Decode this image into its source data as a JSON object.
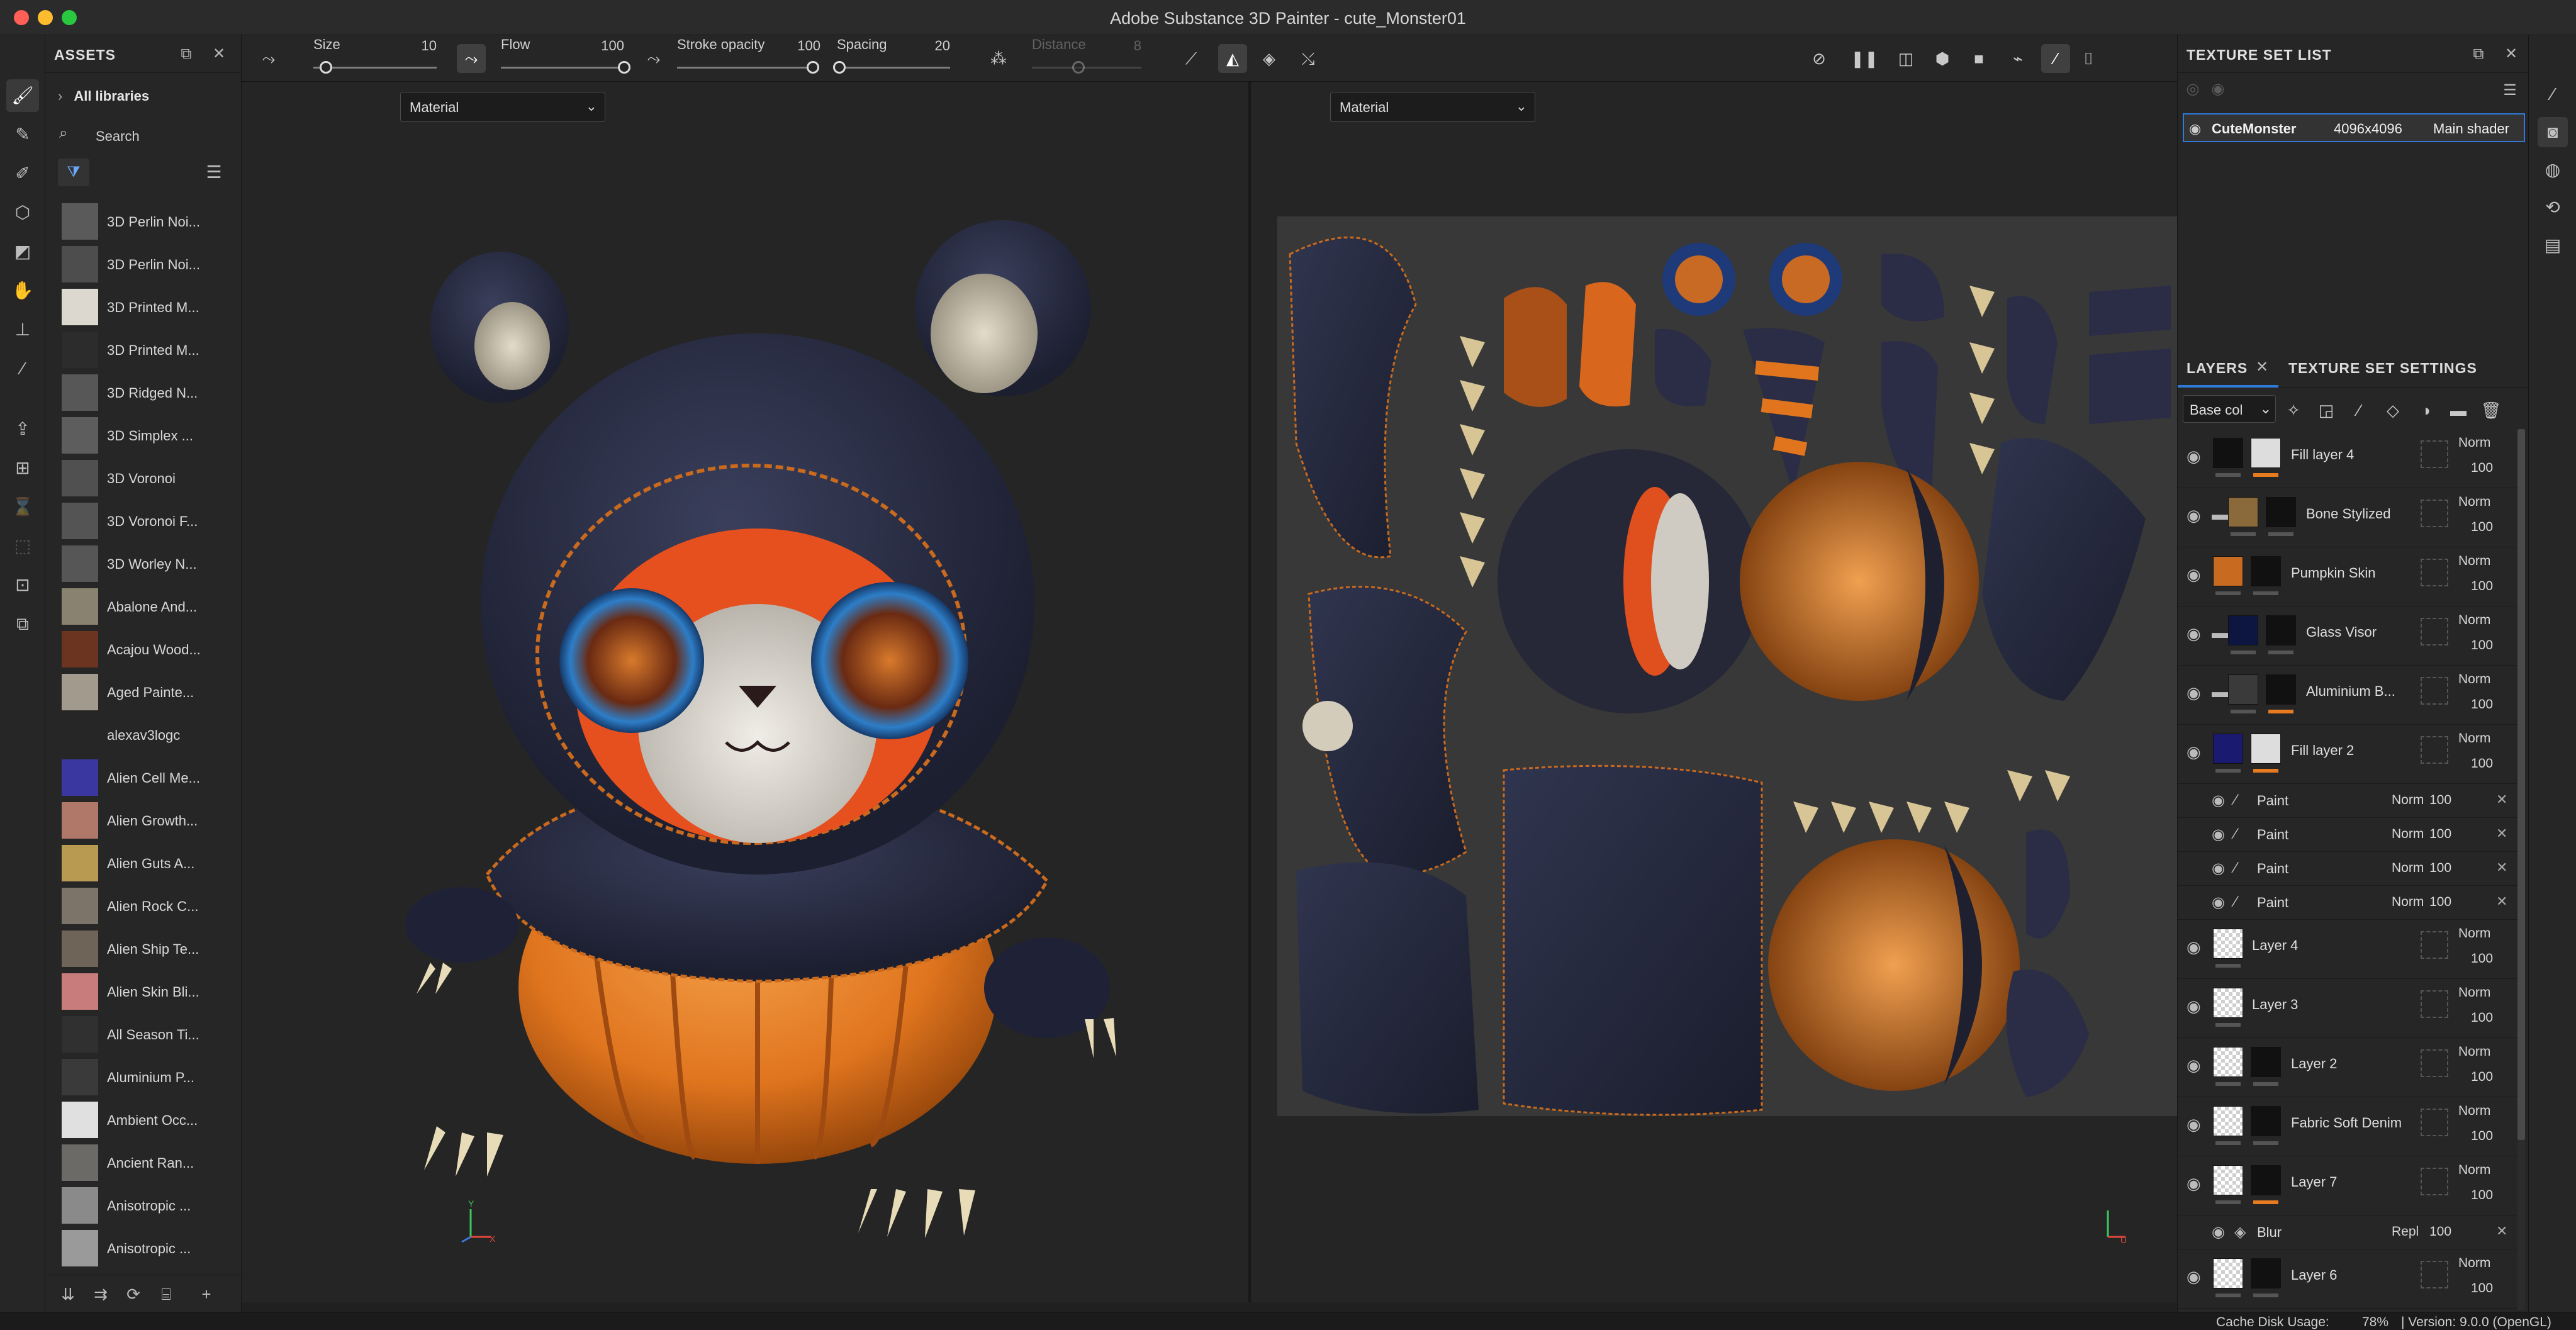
{
  "window": {
    "title": "Adobe Substance 3D Painter - cute_Monster01"
  },
  "tool_strip": {
    "icons": [
      "paint-brush-icon",
      "eraser-icon",
      "projection-icon",
      "geometry-mask-icon",
      "polygon-fill-icon",
      "smudge-icon",
      "clone-stamp-icon",
      "color-picker-icon",
      "export-icon",
      "bake-icon",
      "hidden-tool-icon",
      "hidden-tool-icon",
      "screenshot-icon",
      "send-to-icon"
    ]
  },
  "assets": {
    "title": "ASSETS",
    "library_label": "All libraries",
    "search_placeholder": "Search",
    "items": [
      {
        "label": "3D Perlin Noi...",
        "thumb": "#5a5a5a"
      },
      {
        "label": "3D Perlin Noi...",
        "thumb": "#4d4d4d"
      },
      {
        "label": "3D Printed M...",
        "thumb": "#dcd8cf"
      },
      {
        "label": "3D Printed M...",
        "thumb": "#2c2c2c"
      },
      {
        "label": "3D Ridged N...",
        "thumb": "#575757"
      },
      {
        "label": "3D Simplex ...",
        "thumb": "#5d5d5d"
      },
      {
        "label": "3D Voronoi",
        "thumb": "#505050"
      },
      {
        "label": "3D Voronoi F...",
        "thumb": "#545454"
      },
      {
        "label": "3D Worley N...",
        "thumb": "#565656"
      },
      {
        "label": "Abalone And...",
        "thumb": "#8a8270"
      },
      {
        "label": "Acajou Wood...",
        "thumb": "#6b3420"
      },
      {
        "label": "Aged Painte...",
        "thumb": "#a29a8c"
      },
      {
        "label": "alexav3logc",
        "thumb": "#262626"
      },
      {
        "label": "Alien Cell Me...",
        "thumb": "#3a38a0"
      },
      {
        "label": "Alien Growth...",
        "thumb": "#b07868"
      },
      {
        "label": "Alien Guts A...",
        "thumb": "#b89a50"
      },
      {
        "label": "Alien Rock C...",
        "thumb": "#7c7468"
      },
      {
        "label": "Alien Ship Te...",
        "thumb": "#6e6458"
      },
      {
        "label": "Alien Skin Bli...",
        "thumb": "#c87c7c"
      },
      {
        "label": "All Season Ti...",
        "thumb": "#303030"
      },
      {
        "label": "Aluminium P...",
        "thumb": "#3a3a3a"
      },
      {
        "label": "Ambient Occ...",
        "thumb": "#e0e0e0"
      },
      {
        "label": "Ancient Ran...",
        "thumb": "#6c6a66"
      },
      {
        "label": "Anisotropic ...",
        "thumb": "#8a8a8a"
      },
      {
        "label": "Anisotropic ...",
        "thumb": "#9a9a9a"
      }
    ]
  },
  "toolbar": {
    "size_label": "Size",
    "size_value": "10",
    "size_level": 0.1,
    "flow_label": "Flow",
    "flow_value": "100",
    "flow_level": 1.0,
    "opacity_label": "Stroke opacity",
    "opacity_value": "100",
    "opacity_level": 1.0,
    "spacing_label": "Spacing",
    "spacing_value": "20",
    "spacing_level": 0.02,
    "distance_label": "Distance",
    "distance_value": "8"
  },
  "viewports": {
    "left_mode": "Material",
    "right_mode": "Material"
  },
  "axes": {
    "y": "Y",
    "x": "X",
    "u": "U"
  },
  "texture_set_list": {
    "title": "TEXTURE SET LIST",
    "row": {
      "name": "CuteMonster",
      "resolution": "4096x4096",
      "shader": "Main shader"
    }
  },
  "layers_panel": {
    "tab_layers": "LAYERS",
    "tab_settings": "TEXTURE SET SETTINGS",
    "channel": "Base col",
    "layers": [
      {
        "name": "Fill layer 4",
        "blend": "Norm",
        "opacity": "100",
        "folder": false,
        "th1": "#111",
        "th2": "#ddd",
        "bar2": "#e87a20"
      },
      {
        "name": "Bone Stylized",
        "blend": "Norm",
        "opacity": "100",
        "folder": true,
        "th1": "#8a6a3a",
        "th2": "#111",
        "bar2": ""
      },
      {
        "name": "Pumpkin Skin",
        "blend": "Norm",
        "opacity": "100",
        "folder": false,
        "th1": "#c86a20",
        "th2": "#111",
        "bar2": ""
      },
      {
        "name": "Glass Visor",
        "blend": "Norm",
        "opacity": "100",
        "folder": true,
        "th1": "#0c1640",
        "th2": "#111",
        "bar2": ""
      },
      {
        "name": "Aluminium B...",
        "blend": "Norm",
        "opacity": "100",
        "folder": true,
        "th1": "#3a3a3a",
        "th2": "#111",
        "bar2": "#e87a20"
      },
      {
        "name": "Fill layer 2",
        "blend": "Norm",
        "opacity": "100",
        "folder": false,
        "th1": "#1a1a70",
        "th2": "#ddd",
        "bar2": "#e87a20"
      }
    ],
    "sub_paints": [
      {
        "name": "Paint",
        "blend": "Norm",
        "opacity": "100"
      },
      {
        "name": "Paint",
        "blend": "Norm",
        "opacity": "100"
      },
      {
        "name": "Paint",
        "blend": "Norm",
        "opacity": "100"
      },
      {
        "name": "Paint",
        "blend": "Norm",
        "opacity": "100"
      }
    ],
    "layers_b": [
      {
        "name": "Layer 4",
        "blend": "Norm",
        "opacity": "100",
        "th2": "",
        "bar2": ""
      },
      {
        "name": "Layer 3",
        "blend": "Norm",
        "opacity": "100",
        "th2": "",
        "bar2": ""
      },
      {
        "name": "Layer 2",
        "blend": "Norm",
        "opacity": "100",
        "th2": "#111",
        "bar2": ""
      },
      {
        "name": "Fabric Soft Denim",
        "blend": "Norm",
        "opacity": "100",
        "th2": "#111",
        "bar2": ""
      },
      {
        "name": "Layer 7",
        "blend": "Norm",
        "opacity": "100",
        "th2": "#111",
        "bar2": "#e87a20"
      }
    ],
    "filter": {
      "name": "Blur",
      "blend": "Repl",
      "opacity": "100"
    },
    "last_layer": {
      "name": "Layer 6",
      "blend": "Norm",
      "opacity": "100"
    }
  },
  "status": {
    "cache_label": "Cache Disk Usage:",
    "cache_value": "78%",
    "version": "| Version: 9.0.0 (OpenGL)"
  },
  "colors": {
    "accent": "#2f7ad8",
    "orange": "#e87a20",
    "navy": "#2b2f48"
  }
}
